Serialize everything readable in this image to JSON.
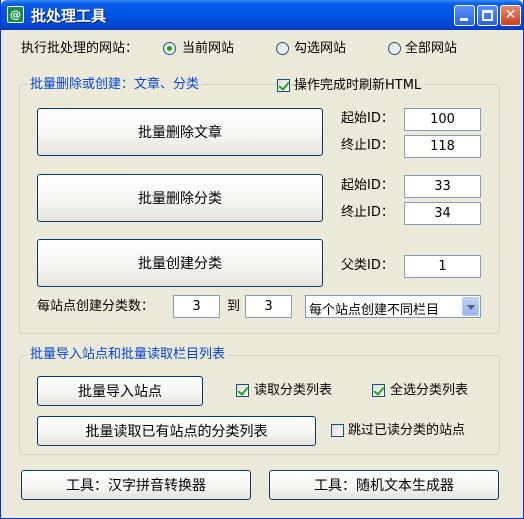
{
  "window": {
    "title": "批处理工具"
  },
  "site_select": {
    "label": "执行批处理的网站：",
    "options": [
      {
        "label": "当前网站",
        "checked": true
      },
      {
        "label": "勾选网站",
        "checked": false
      },
      {
        "label": "全部网站",
        "checked": false
      }
    ]
  },
  "group1": {
    "legend": "批量删除或创建：文章、分类",
    "refresh_checkbox": {
      "label": "操作完成时刷新HTML",
      "checked": true
    },
    "delete_articles_button": "批量删除文章",
    "delete_categories_button": "批量删除分类",
    "create_categories_button": "批量创建分类",
    "articles": {
      "start_label": "起始ID：",
      "start_value": "100",
      "end_label": "终止ID：",
      "end_value": "118"
    },
    "categories": {
      "start_label": "起始ID：",
      "start_value": "33",
      "end_label": "终止ID：",
      "end_value": "34"
    },
    "parent": {
      "label": "父类ID：",
      "value": "1"
    },
    "per_site": {
      "label": "每站点创建分类数：",
      "from_value": "3",
      "to_label": "到",
      "to_value": "3"
    },
    "mode_select": {
      "selected": "每个站点创建不同栏目"
    }
  },
  "group2": {
    "legend": "批量导入站点和批量读取栏目列表",
    "import_sites_button": "批量导入站点",
    "read_categories_button": "批量读取已有站点的分类列表",
    "read_list_checkbox": {
      "label": "读取分类列表",
      "checked": true
    },
    "select_all_checkbox": {
      "label": "全选分类列表",
      "checked": true
    },
    "skip_read_checkbox": {
      "label": "跳过已读分类的站点",
      "checked": false
    }
  },
  "footer": {
    "pinyin_button": "工具：汉字拼音转换器",
    "random_text_button": "工具：随机文本生成器"
  }
}
